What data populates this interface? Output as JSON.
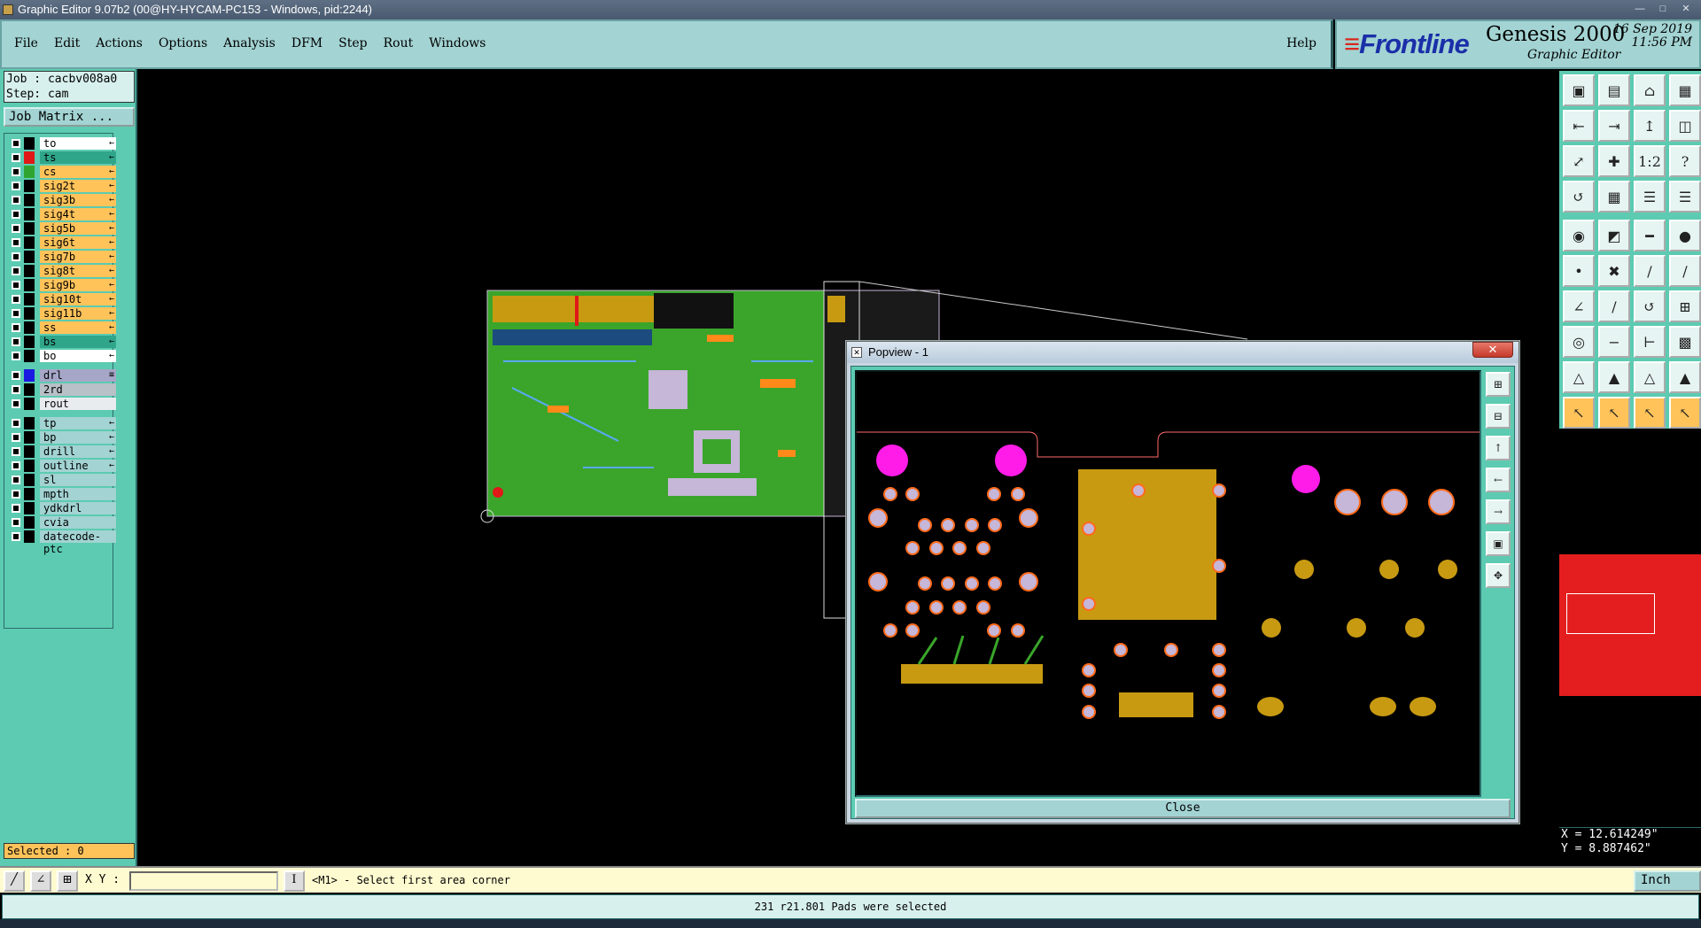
{
  "window": {
    "title": "Graphic Editor 9.07b2 (00@HY-HYCAM-PC153 - Windows, pid:2244)"
  },
  "menu": {
    "items": [
      "File",
      "Edit",
      "Actions",
      "Options",
      "Analysis",
      "DFM",
      "Step",
      "Rout",
      "Windows"
    ],
    "help": "Help"
  },
  "brand": {
    "logo": "Frontline",
    "product": "Genesis 2000",
    "subtitle": "Graphic Editor",
    "date": "16 Sep 2019",
    "time": "11:56 PM"
  },
  "job": {
    "job_line": "Job : cacbv008a0",
    "step_line": "Step: cam",
    "matrix_button": "Job Matrix ..."
  },
  "layers": [
    {
      "name": "to",
      "bg": "#ffffff",
      "swatch": "#000000",
      "arrow": "←"
    },
    {
      "name": "ts",
      "bg": "#2fa58a",
      "swatch": "#e01818",
      "arrow": "←"
    },
    {
      "name": "cs",
      "bg": "#ffc35a",
      "swatch": "#2fa52f",
      "arrow": "←"
    },
    {
      "name": "sig2t",
      "bg": "#ffc35a",
      "swatch": "#000000",
      "arrow": "←"
    },
    {
      "name": "sig3b",
      "bg": "#ffc35a",
      "swatch": "#000000",
      "arrow": "←"
    },
    {
      "name": "sig4t",
      "bg": "#ffc35a",
      "swatch": "#000000",
      "arrow": "←"
    },
    {
      "name": "sig5b",
      "bg": "#ffc35a",
      "swatch": "#000000",
      "arrow": "←"
    },
    {
      "name": "sig6t",
      "bg": "#ffc35a",
      "swatch": "#000000",
      "arrow": "←"
    },
    {
      "name": "sig7b",
      "bg": "#ffc35a",
      "swatch": "#000000",
      "arrow": "←"
    },
    {
      "name": "sig8t",
      "bg": "#ffc35a",
      "swatch": "#000000",
      "arrow": "←"
    },
    {
      "name": "sig9b",
      "bg": "#ffc35a",
      "swatch": "#000000",
      "arrow": "←"
    },
    {
      "name": "sig10t",
      "bg": "#ffc35a",
      "swatch": "#000000",
      "arrow": "←"
    },
    {
      "name": "sig11b",
      "bg": "#ffc35a",
      "swatch": "#000000",
      "arrow": "←"
    },
    {
      "name": "ss",
      "bg": "#ffc35a",
      "swatch": "#000000",
      "arrow": "←"
    },
    {
      "name": "bs",
      "bg": "#2fa58a",
      "swatch": "#000000",
      "arrow": "←"
    },
    {
      "name": "bo",
      "bg": "#ffffff",
      "swatch": "#000000",
      "arrow": "←"
    },
    {
      "name": "drl",
      "bg": "#a6a6c8",
      "swatch": "#1a1ae0",
      "arrow": "≡"
    },
    {
      "name": "2rd",
      "bg": "#b8c0c8",
      "swatch": "#000000",
      "arrow": ""
    },
    {
      "name": "rout",
      "bg": "#e8ecef",
      "swatch": "#000000",
      "arrow": ""
    },
    {
      "name": "tp",
      "bg": "#a3d3d3",
      "swatch": "#000000",
      "arrow": "←"
    },
    {
      "name": "bp",
      "bg": "#a3d3d3",
      "swatch": "#000000",
      "arrow": "←"
    },
    {
      "name": "drill",
      "bg": "#a3d3d3",
      "swatch": "#000000",
      "arrow": "←"
    },
    {
      "name": "outline",
      "bg": "#a3d3d3",
      "swatch": "#000000",
      "arrow": "←"
    },
    {
      "name": "sl",
      "bg": "#a3d3d3",
      "swatch": "#000000",
      "arrow": ""
    },
    {
      "name": "mpth",
      "bg": "#a3d3d3",
      "swatch": "#000000",
      "arrow": ""
    },
    {
      "name": "ydkdrl",
      "bg": "#a3d3d3",
      "swatch": "#000000",
      "arrow": ""
    },
    {
      "name": "cvia",
      "bg": "#a3d3d3",
      "swatch": "#000000",
      "arrow": ""
    },
    {
      "name": "datecode-ptc",
      "bg": "#a3d3d3",
      "swatch": "#000000",
      "arrow": ""
    }
  ],
  "selected": "Selected : 0",
  "popview": {
    "title": "Popview - 1",
    "close_x": "✕",
    "close_button": "Close"
  },
  "coords": {
    "x": "X = 12.614249\"",
    "y": "Y = 8.887462\""
  },
  "command": {
    "xy_label": "X Y :",
    "prompt": "<M1> - Select first area corner",
    "unit": "Inch"
  },
  "status": "231 r21.801 Pads were selected",
  "colors": {
    "panel": "#5ccbb1",
    "menubar": "#a3d3d3",
    "board_green": "#3aa52a",
    "gold": "#c89a12",
    "magenta": "#ff1ce8",
    "pad": "#c6b6d8"
  }
}
